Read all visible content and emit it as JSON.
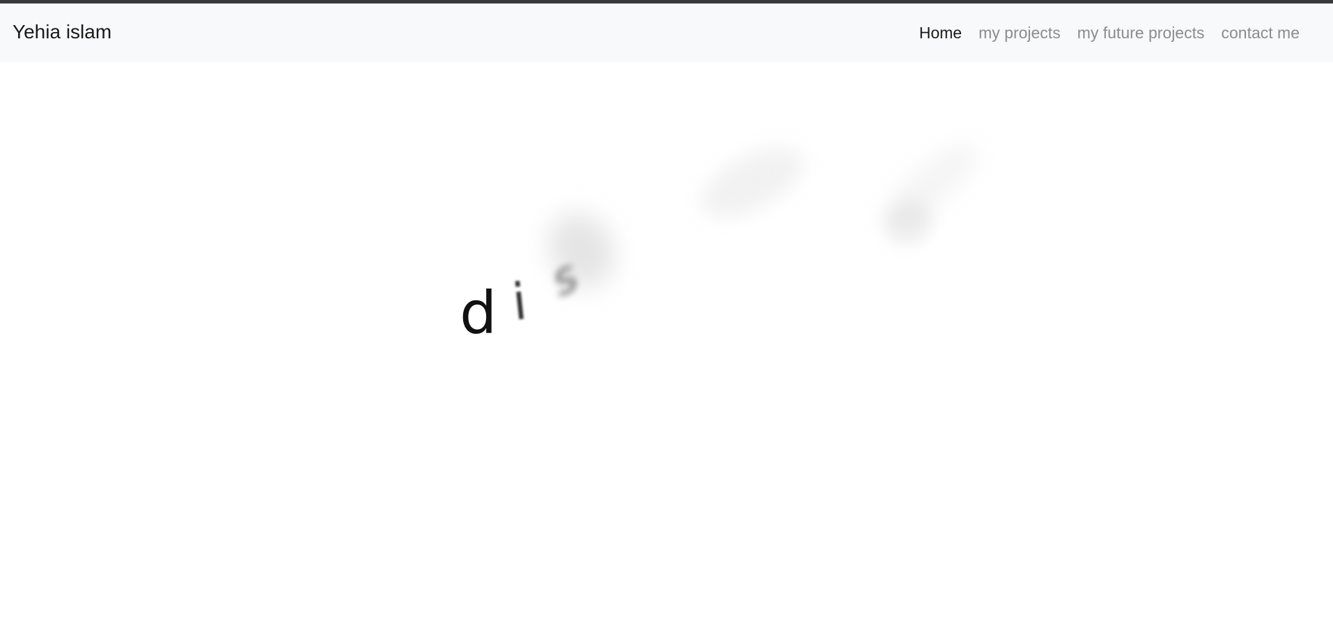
{
  "brand": {
    "name": "Yehia islam"
  },
  "nav": {
    "links": [
      {
        "label": "Home",
        "active": true
      },
      {
        "label": "my projects",
        "active": false
      },
      {
        "label": "my future projects",
        "active": false
      },
      {
        "label": "contact me",
        "active": false
      }
    ]
  },
  "hero": {
    "letters": [
      "d",
      "i",
      "s"
    ]
  },
  "colors": {
    "navbar_bg": "#f8f9fa",
    "active_link": "#1a1a1a",
    "inactive_link": "#8c8c8c",
    "top_border": "#3a3a3a"
  }
}
